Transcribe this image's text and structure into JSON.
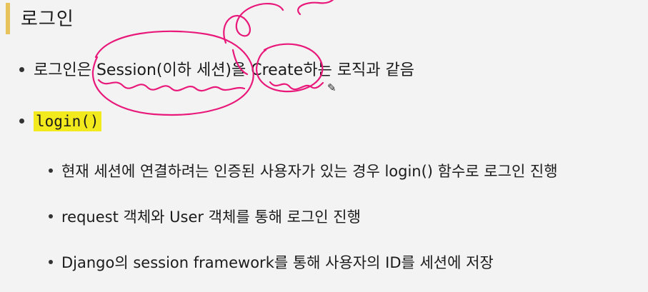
{
  "slide": {
    "title": "로그인",
    "bullets": [
      {
        "text": "로그인은 Session(이하 세션)을 Create하는 로직과 같음"
      },
      {
        "code": "login()"
      }
    ],
    "sub_bullets": [
      "현재 세션에 연결하려는 인증된 사용자가 있는 경우 login() 함수로 로그인 진행",
      "request 객체와 User 객체를 통해 로그인 진행",
      "Django의 session framework를 통해 사용자의 ID를 세션에 저장"
    ]
  },
  "colors": {
    "accent_bar": "#e8c25a",
    "highlight": "#f3ea1d",
    "annotation_ink": "#e8197a"
  },
  "icons": {
    "cursor": "pencil-cursor-icon"
  }
}
